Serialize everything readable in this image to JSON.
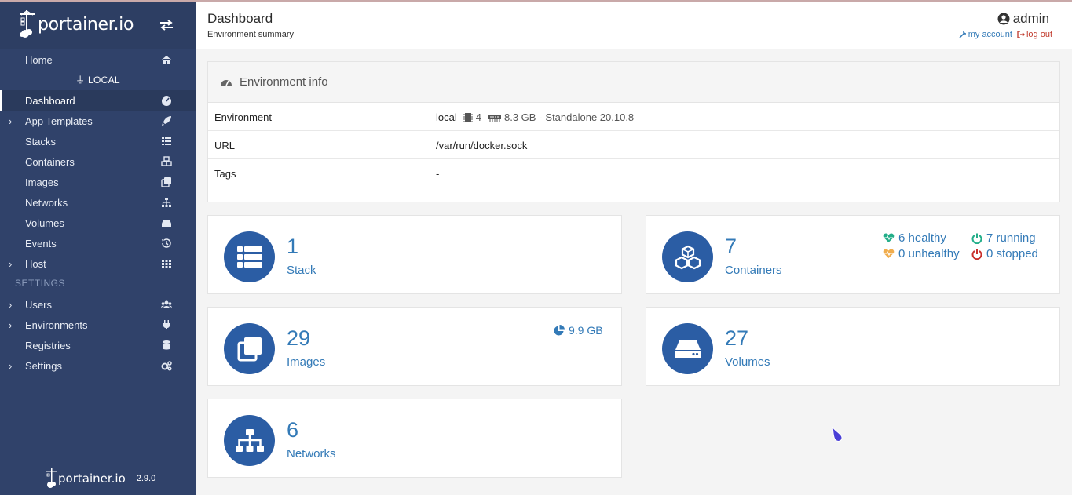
{
  "app": {
    "logo_text": "portainer.io",
    "version": "2.9.0"
  },
  "sidebar": {
    "home": "Home",
    "endpoint": "LOCAL",
    "items": [
      {
        "label": "Dashboard",
        "icon": "dashboard-icon"
      },
      {
        "label": "App Templates",
        "icon": "rocket-icon"
      },
      {
        "label": "Stacks",
        "icon": "list-icon"
      },
      {
        "label": "Containers",
        "icon": "cubes-icon"
      },
      {
        "label": "Images",
        "icon": "clone-icon"
      },
      {
        "label": "Networks",
        "icon": "sitemap-icon"
      },
      {
        "label": "Volumes",
        "icon": "hdd-icon"
      },
      {
        "label": "Events",
        "icon": "history-icon"
      },
      {
        "label": "Host",
        "icon": "th-icon"
      }
    ],
    "settings_section": "SETTINGS",
    "settings_items": [
      {
        "label": "Users",
        "icon": "users-icon"
      },
      {
        "label": "Environments",
        "icon": "plug-icon"
      },
      {
        "label": "Registries",
        "icon": "database-icon"
      },
      {
        "label": "Settings",
        "icon": "cogs-icon"
      }
    ]
  },
  "header": {
    "title": "Dashboard",
    "subtitle": "Environment summary",
    "user": "admin",
    "my_account": "my account",
    "log_out": "log out"
  },
  "env_info": {
    "title": "Environment info",
    "rows": [
      {
        "key": "Environment",
        "name": "local",
        "cpu": "4",
        "memory": "8.3 GB",
        "suffix": "- Standalone 20.10.8"
      },
      {
        "key": "URL",
        "value": "/var/run/docker.sock"
      },
      {
        "key": "Tags",
        "value": "-"
      }
    ]
  },
  "widgets": {
    "stacks": {
      "count": "1",
      "label": "Stack"
    },
    "containers": {
      "count": "7",
      "label": "Containers",
      "healthy": "6 healthy",
      "unhealthy": "0 unhealthy",
      "running": "7 running",
      "stopped": "0 stopped"
    },
    "images": {
      "count": "29",
      "label": "Images",
      "size": "9.9 GB"
    },
    "volumes": {
      "count": "27",
      "label": "Volumes"
    },
    "networks": {
      "count": "6",
      "label": "Networks"
    }
  },
  "colors": {
    "sidebar": "#30426a",
    "accent": "#337ab7",
    "widget_icon": "#2b5da4",
    "healthy": "#23ae89",
    "unhealthy": "#f0ad4e",
    "stopped": "#c9302c"
  }
}
